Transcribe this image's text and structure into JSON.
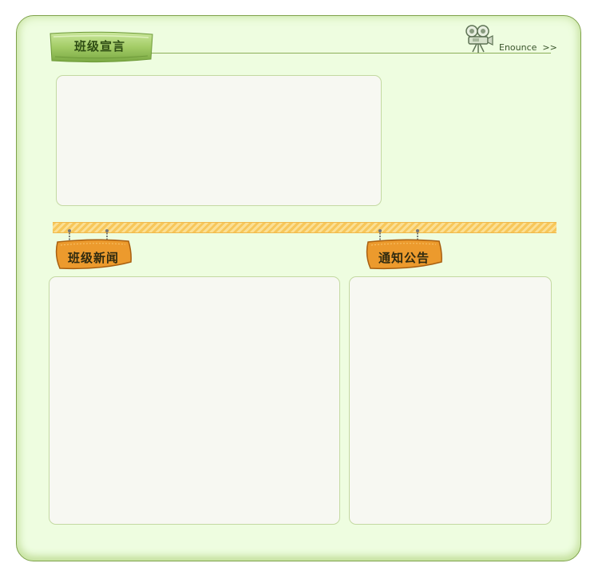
{
  "header": {
    "title": "班级宣言",
    "more_link": "Enounce  >>"
  },
  "sections": {
    "news": {
      "label": "班级新闻"
    },
    "notice": {
      "label": "通知公告"
    }
  },
  "icons": {
    "header": "camera-icon",
    "boards": "hanging-sign"
  },
  "colors": {
    "background": "#eefde0",
    "border": "#7ea24a",
    "stripe": "#f7c75a",
    "sign": "#e9962b"
  }
}
